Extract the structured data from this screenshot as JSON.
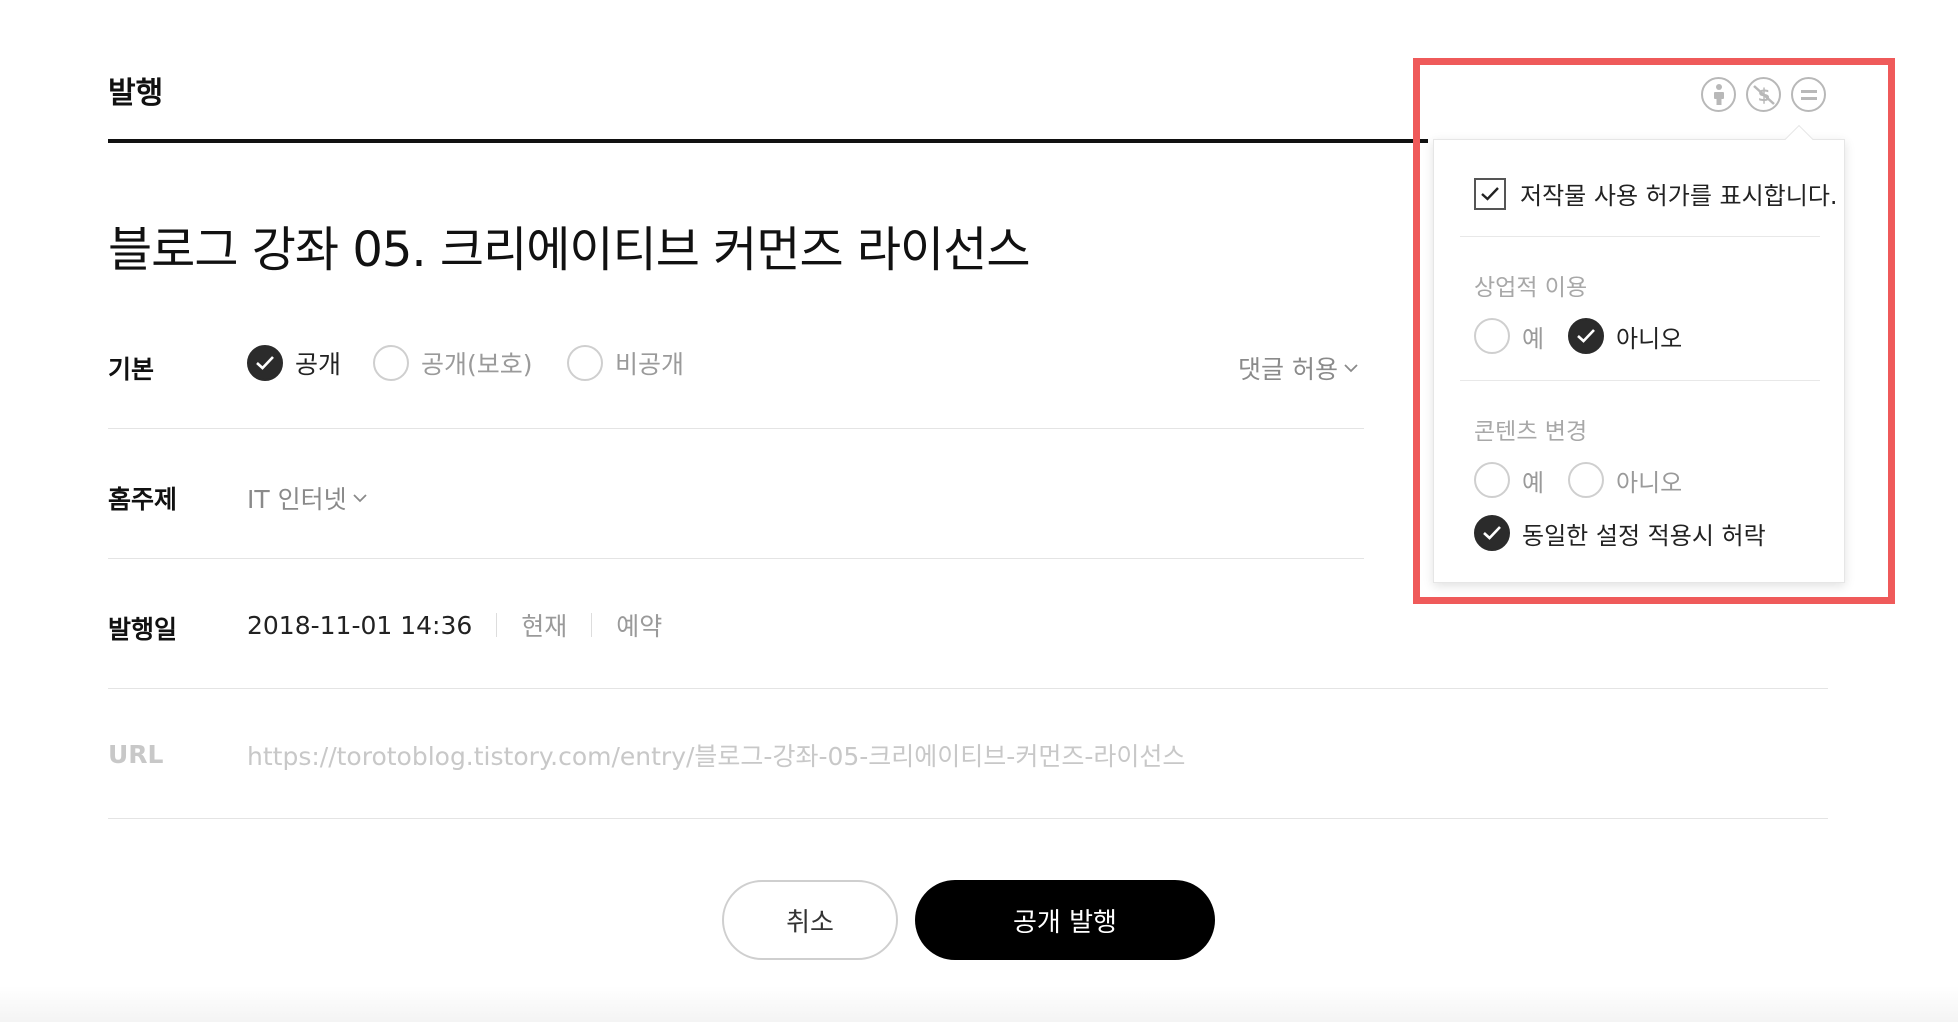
{
  "header": {
    "title": "발행"
  },
  "post": {
    "title": "블로그 강좌 05. 크리에이티브 커먼즈 라이선스"
  },
  "visibility": {
    "label": "기본",
    "options": [
      {
        "label": "공개",
        "checked": true
      },
      {
        "label": "공개(보호)",
        "checked": false
      },
      {
        "label": "비공개",
        "checked": false
      }
    ],
    "comments_label": "댓글 허용"
  },
  "category": {
    "label": "홈주제",
    "value": "IT 인터넷"
  },
  "publish_date": {
    "label": "발행일",
    "value": "2018-11-01 14:36",
    "now_label": "현재",
    "reserve_label": "예약"
  },
  "url": {
    "label": "URL",
    "value": "https://torotoblog.tistory.com/entry/블로그-강좌-05-크리에이티브-커먼즈-라이선스"
  },
  "buttons": {
    "cancel": "취소",
    "publish": "공개 발행"
  },
  "license_popover": {
    "icons": [
      "attribution-icon",
      "noncommercial-icon",
      "noderivatives-icon"
    ],
    "show_license_label": "저작물 사용 허가를 표시합니다.",
    "show_license_checked": true,
    "commercial": {
      "title": "상업적 이용",
      "yes": "예",
      "yes_checked": false,
      "no": "아니오",
      "no_checked": true
    },
    "modification": {
      "title": "콘텐츠 변경",
      "yes": "예",
      "yes_checked": false,
      "no": "아니오",
      "no_checked": false,
      "share_alike": "동일한 설정 적용시 허락",
      "share_alike_checked": true
    }
  },
  "colors": {
    "highlight": "#ef5a5a",
    "checked": "#2b2b2b",
    "primary_button": "#000000"
  }
}
